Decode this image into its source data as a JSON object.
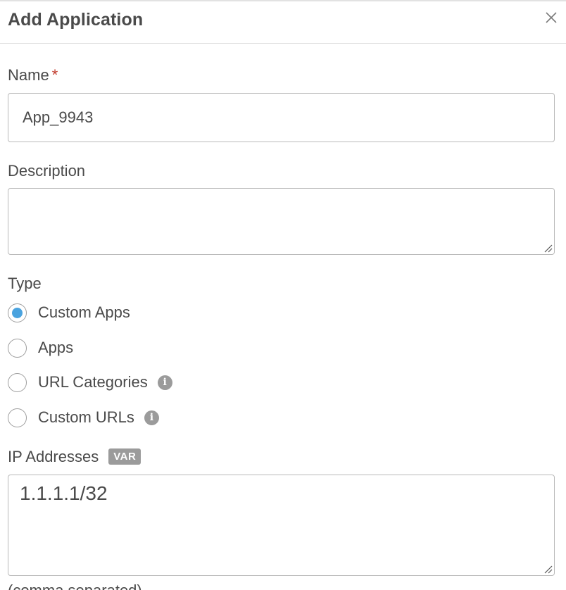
{
  "dialog": {
    "title": "Add Application",
    "close_icon": "close-icon"
  },
  "form": {
    "name": {
      "label": "Name",
      "required_marker": "*",
      "value": "App_9943"
    },
    "description": {
      "label": "Description",
      "value": ""
    },
    "type": {
      "label": "Type",
      "selected": "Custom Apps",
      "options": [
        {
          "label": "Custom Apps",
          "checked": true,
          "info": false
        },
        {
          "label": "Apps",
          "checked": false,
          "info": false
        },
        {
          "label": "URL Categories",
          "checked": false,
          "info": true
        },
        {
          "label": "Custom URLs",
          "checked": false,
          "info": true
        }
      ]
    },
    "ip_addresses": {
      "label": "IP Addresses",
      "badge": "VAR",
      "value": "1.1.1.1/32",
      "hint": "(comma separated)"
    }
  },
  "colors": {
    "radio_selected": "#4aa3df",
    "required": "#c0392b",
    "badge_bg": "#9b9b9b",
    "border": "#b9b9b9"
  }
}
